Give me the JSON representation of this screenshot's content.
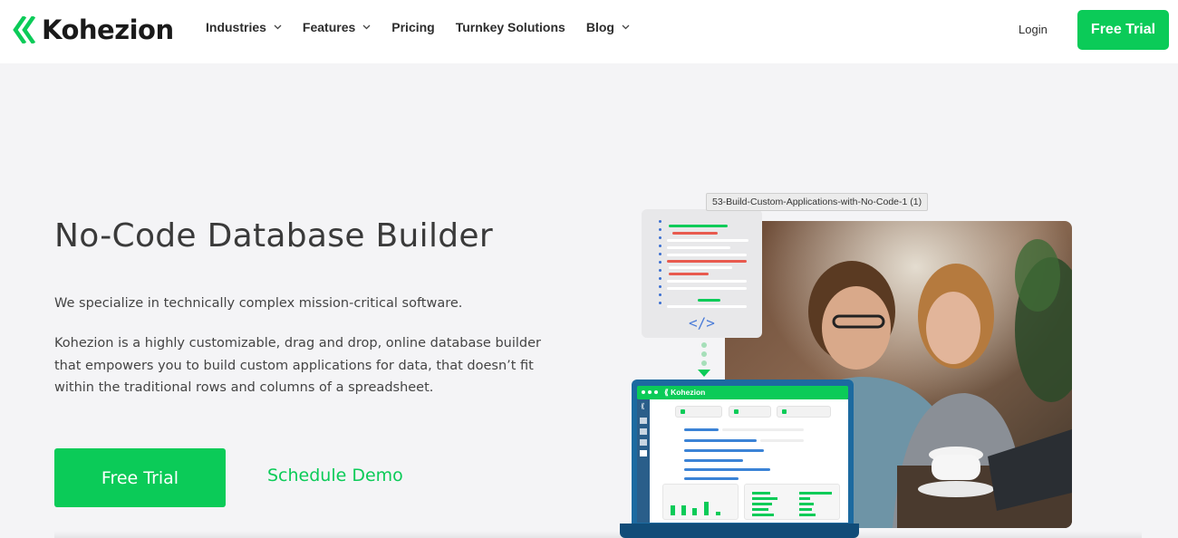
{
  "brand": {
    "name": "Kohezion",
    "logo_icon": "kohezion-chevrons-icon",
    "accent": "#0bcb58"
  },
  "nav": {
    "items": [
      {
        "label": "Industries",
        "has_dropdown": true
      },
      {
        "label": "Features",
        "has_dropdown": true
      },
      {
        "label": "Pricing",
        "has_dropdown": false
      },
      {
        "label": "Turnkey Solutions",
        "has_dropdown": false
      },
      {
        "label": "Blog",
        "has_dropdown": true
      }
    ],
    "login_label": "Login",
    "trial_label": "Free Trial"
  },
  "hero": {
    "title": "No-Code Database Builder",
    "tagline": "We specialize in technically complex mission-critical software.",
    "body": "Kohezion is a highly customizable, drag and drop, online database builder that empowers you to build custom applications for data, that doesn’t fit within the traditional rows and columns of a spreadsheet.",
    "primary_cta": "Free Trial",
    "secondary_cta": "Schedule Demo"
  },
  "illustration": {
    "tooltip": "53-Build-Custom-Applications-with-No-Code-1 (1)",
    "code_symbol": "</>",
    "screen_brand": "⟪ Kohezion",
    "sidebar_glyph": "⟪"
  }
}
